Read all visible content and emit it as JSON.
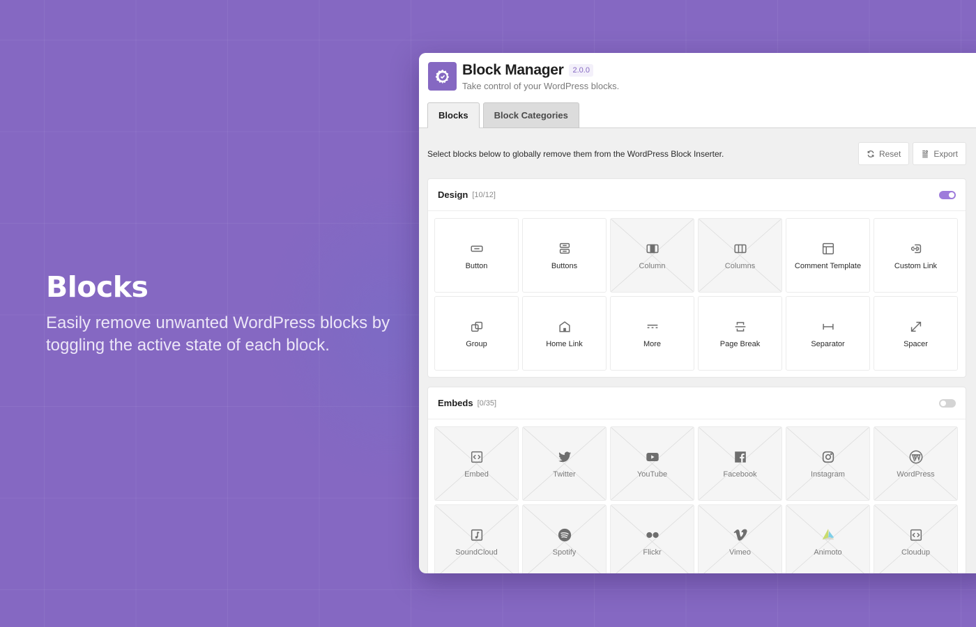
{
  "hero": {
    "title": "Blocks",
    "description": "Easily remove unwanted WordPress blocks by toggling the active state of each block."
  },
  "app": {
    "logo_icon": "gear-check-icon",
    "title": "Block Manager",
    "version": "2.0.0",
    "subtitle": "Take control of your WordPress blocks.",
    "accent_color": "#8568C2"
  },
  "tabs": [
    {
      "label": "Blocks",
      "active": true
    },
    {
      "label": "Block Categories",
      "active": false
    }
  ],
  "toolbar": {
    "intro": "Select blocks below to globally remove them from the WordPress Block Inserter.",
    "reset_label": "Reset",
    "reset_icon": "refresh-icon",
    "export_label": "Export",
    "export_icon": "export-icon"
  },
  "sections": [
    {
      "title": "Design",
      "count": "[10/12]",
      "enabled": true,
      "blocks": [
        {
          "label": "Button",
          "icon": "button",
          "enabled": true
        },
        {
          "label": "Buttons",
          "icon": "buttons",
          "enabled": true
        },
        {
          "label": "Column",
          "icon": "column",
          "enabled": false
        },
        {
          "label": "Columns",
          "icon": "columns",
          "enabled": false
        },
        {
          "label": "Comment Template",
          "icon": "layout",
          "enabled": true
        },
        {
          "label": "Custom Link",
          "icon": "custom-link",
          "enabled": true
        },
        {
          "label": "Group",
          "icon": "group",
          "enabled": true
        },
        {
          "label": "Home Link",
          "icon": "home",
          "enabled": true
        },
        {
          "label": "More",
          "icon": "more",
          "enabled": true
        },
        {
          "label": "Page Break",
          "icon": "page-break",
          "enabled": true
        },
        {
          "label": "Separator",
          "icon": "separator",
          "enabled": true
        },
        {
          "label": "Spacer",
          "icon": "spacer",
          "enabled": true
        }
      ]
    },
    {
      "title": "Embeds",
      "count": "[0/35]",
      "enabled": false,
      "blocks": [
        {
          "label": "Embed",
          "icon": "embed",
          "enabled": false
        },
        {
          "label": "Twitter",
          "icon": "twitter",
          "enabled": false
        },
        {
          "label": "YouTube",
          "icon": "youtube",
          "enabled": false
        },
        {
          "label": "Facebook",
          "icon": "facebook",
          "enabled": false
        },
        {
          "label": "Instagram",
          "icon": "instagram",
          "enabled": false
        },
        {
          "label": "WordPress",
          "icon": "wordpress",
          "enabled": false
        },
        {
          "label": "SoundCloud",
          "icon": "soundcloud",
          "enabled": false
        },
        {
          "label": "Spotify",
          "icon": "spotify",
          "enabled": false
        },
        {
          "label": "Flickr",
          "icon": "flickr",
          "enabled": false
        },
        {
          "label": "Vimeo",
          "icon": "vimeo",
          "enabled": false
        },
        {
          "label": "Animoto",
          "icon": "animoto",
          "enabled": false
        },
        {
          "label": "Cloudup",
          "icon": "embed",
          "enabled": false
        }
      ]
    }
  ]
}
